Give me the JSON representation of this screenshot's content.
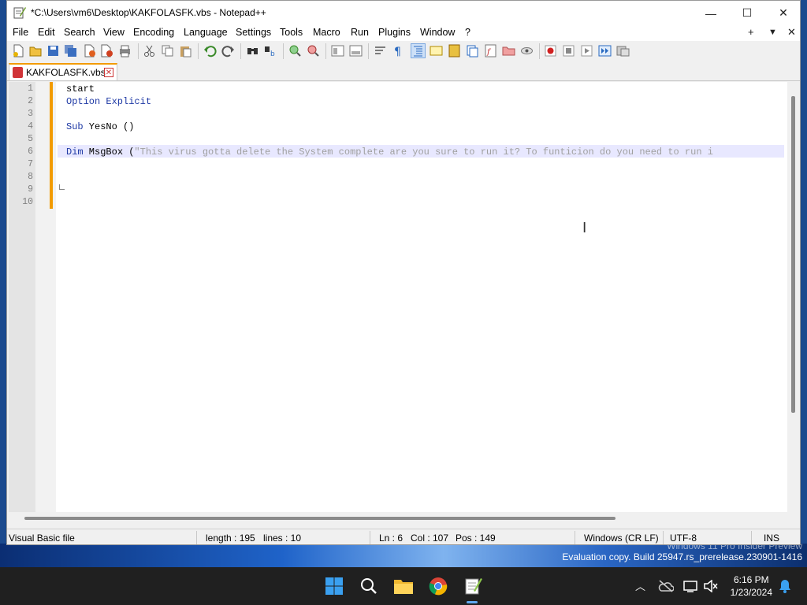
{
  "window": {
    "title": "*C:\\Users\\vm6\\Desktop\\KAKFOLASFK.vbs - Notepad++",
    "minimize_glyph": "—",
    "maximize_glyph": "☐",
    "close_glyph": "✕"
  },
  "menu": {
    "items": [
      "File",
      "Edit",
      "Search",
      "View",
      "Encoding",
      "Language",
      "Settings",
      "Tools",
      "Macro",
      "Run",
      "Plugins",
      "Window",
      "?"
    ],
    "right": {
      "plus": "+",
      "dropdown": "▼",
      "close": "✕"
    }
  },
  "toolbar": {
    "icons": [
      "new-file-icon",
      "open-file-icon",
      "save-icon",
      "save-all-icon",
      "close-icon",
      "close-all-icon",
      "print-icon",
      "cut-icon",
      "copy-icon",
      "paste-icon",
      "undo-icon",
      "redo-icon",
      "find-icon",
      "replace-icon",
      "zoom-in-icon",
      "zoom-out-icon",
      "sync-vertical-icon",
      "sync-horizontal-icon",
      "word-wrap-icon",
      "show-all-chars-icon",
      "indent-guide-icon",
      "lang-udl-icon",
      "doc-map-icon",
      "doc-list-icon",
      "function-list-icon",
      "folder-workspace-icon",
      "monitor-icon",
      "record-macro-icon",
      "stop-macro-icon",
      "play-macro-icon",
      "run-macro-multiple-icon",
      "save-macro-icon"
    ]
  },
  "tab": {
    "label": "KAKFOLASFK.vbs",
    "close_glyph": "✕"
  },
  "editor": {
    "line_numbers": [
      "1",
      "2",
      "3",
      "4",
      "5",
      "6",
      "7",
      "8",
      "9",
      "10"
    ],
    "lines": {
      "l1": "start",
      "l2": "Option Explicit",
      "l4_kw": "Sub",
      "l4_rest": " YesNo ()",
      "l6_kw": "Dim",
      "l6_rest": " MsgBox (",
      "l6_str": "\"This virus gotta delete the System complete are you sure to run it? To funticion do you need to run i"
    }
  },
  "status": {
    "file_type": "Visual Basic file",
    "length": "length : 195",
    "lines": "lines : 10",
    "ln": "Ln : 6",
    "col": "Col : 107",
    "pos": "Pos : 149",
    "eol": "Windows (CR LF)",
    "encoding": "UTF-8",
    "mode": "INS"
  },
  "watermark": {
    "line1": "Windows 11 Pro Insider Preview",
    "line2": "Evaluation copy. Build 25947.rs_prerelease.230901-1416"
  },
  "taskbar": {
    "time": "6:16 PM",
    "date": "1/23/2024",
    "tray_chevron": "^"
  }
}
